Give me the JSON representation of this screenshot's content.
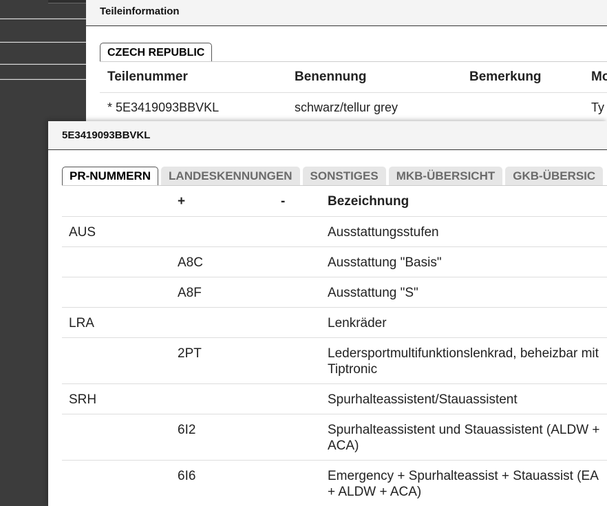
{
  "background_panel": {
    "title": "Teileinformation",
    "country_tab": "CZECH REPUBLIC",
    "columns": [
      "Teilenummer",
      "Benennung",
      "Bemerkung",
      "Mo"
    ],
    "row": {
      "teilenummer": "* 5E3419093BBVKL",
      "benennung": "schwarz/tellur grey",
      "bemerkung": "",
      "mo": "Ty"
    }
  },
  "dialog": {
    "title": "5E3419093BBVKL",
    "tabs": [
      "PR-NUMMERN",
      "LANDESKENNUNGEN",
      "SONSTIGES",
      "MKB-ÜBERSICHT",
      "GKB-ÜBERSIC"
    ],
    "active_tab": "PR-NUMMERN",
    "table": {
      "headers": {
        "col1": "",
        "plus": "+",
        "minus": "-",
        "bezeichnung": "Bezeichnung"
      },
      "rows": [
        {
          "family": "AUS",
          "plus": "",
          "minus": "",
          "bezeichnung": "Ausstattungsstufen"
        },
        {
          "family": "",
          "plus": "A8C",
          "minus": "",
          "bezeichnung": "Ausstattung \"Basis\""
        },
        {
          "family": "",
          "plus": "A8F",
          "minus": "",
          "bezeichnung": "Ausstattung \"S\""
        },
        {
          "family": "LRA",
          "plus": "",
          "minus": "",
          "bezeichnung": "Lenkräder"
        },
        {
          "family": "",
          "plus": "2PT",
          "minus": "",
          "bezeichnung": "Ledersportmultifunktionslenkrad, beheizbar mit Tiptronic"
        },
        {
          "family": "SRH",
          "plus": "",
          "minus": "",
          "bezeichnung": "Spurhalteassistent/Stauassistent"
        },
        {
          "family": "",
          "plus": "6I2",
          "minus": "",
          "bezeichnung": "Spurhalteassistent und Stauassistent (ALDW + ACA)"
        },
        {
          "family": "",
          "plus": "6I6",
          "minus": "",
          "bezeichnung": "Emergency + Spurhalteassist + Stauassist (EA + ALDW + ACA)"
        }
      ]
    }
  }
}
